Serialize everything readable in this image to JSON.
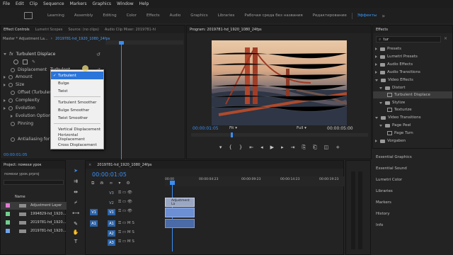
{
  "menu": [
    "File",
    "Edit",
    "Clip",
    "Sequence",
    "Markers",
    "Graphics",
    "Window",
    "Help"
  ],
  "workspaces": [
    "Learning",
    "Assembly",
    "Editing",
    "Color",
    "Effects",
    "Audio",
    "Graphics",
    "Libraries",
    "Рабочая среда без названия",
    "Редактирование",
    "Эффекты"
  ],
  "effect_controls": {
    "tabs": [
      "Effect Controls",
      "Lumetri Scopes",
      "Source: (no clips)",
      "Audio Clip Mixer: 2019781-hl"
    ],
    "master_label": "Master * Adjustment La...",
    "sequence_label": "2019781-hd_1920_1080_24fps",
    "effect_name": "Turbulent Displace",
    "properties": [
      "Displacement",
      "Amount",
      "Size",
      "Offset (Turbulen...",
      "Complexity",
      "Evolution",
      "Evolution Options",
      "Pinning",
      "",
      "Antialiasing for ..."
    ],
    "displacement_value": "Turbulent",
    "timecode": "00:00:01:05"
  },
  "dropdown": {
    "items": [
      "Turbulent",
      "Bulge",
      "Twist",
      "Turbulent Smoother",
      "Bulge Smoother",
      "Twist Smoother",
      "Vertical Displacement",
      "Horizontal Displacement",
      "Cross Displacement"
    ],
    "selected": "Turbulent"
  },
  "program": {
    "title": "Program: 2019781-hd_1920_1080_24fps",
    "timecode": "00:00:01:05",
    "fit": "Fit",
    "quality": "Full",
    "duration": "00:00:05:00"
  },
  "effects_panel": {
    "title": "Effects",
    "search": "tur",
    "items": [
      {
        "label": "Presets",
        "type": "folder"
      },
      {
        "label": "Lumetri Presets",
        "type": "folder"
      },
      {
        "label": "Audio Effects",
        "type": "folder"
      },
      {
        "label": "Audio Transitions",
        "type": "folder"
      },
      {
        "label": "Video Effects",
        "type": "folder"
      },
      {
        "label": "Distort",
        "type": "folder"
      },
      {
        "label": "Turbulent Displace",
        "type": "effect"
      },
      {
        "label": "Stylize",
        "type": "folder"
      },
      {
        "label": "Texturize",
        "type": "effect"
      },
      {
        "label": "Video Transitions",
        "type": "folder"
      },
      {
        "label": "Page Peel",
        "type": "folder"
      },
      {
        "label": "Page Turn",
        "type": "effect"
      },
      {
        "label": "Vorgaben",
        "type": "folder"
      }
    ],
    "side_panels": [
      "Essential Graphics",
      "Essential Sound",
      "Lumetri Color",
      "Libraries",
      "Markers",
      "History",
      "Info"
    ]
  },
  "project": {
    "title": "Project: помехи урок",
    "file": "помехи урок.prproj",
    "column": "Name",
    "items": [
      "Adjustment Layer",
      "1994829-hd_1920...",
      "2019781-hd_1920...",
      "2019781-hd_1920..."
    ]
  },
  "timeline": {
    "title": "2019781-hd_1920_1080_24fps",
    "timecode": "00:00:01:05",
    "ruler": [
      "00:00",
      "00:00:04:23",
      "00:00:09:23",
      "00:00:14:23",
      "00:00:19:23"
    ],
    "video_tracks": [
      "V3",
      "V2",
      "V1"
    ],
    "audio_tracks": [
      "A1",
      "A2",
      "A3"
    ],
    "source_v": "V1",
    "source_a": "A1",
    "clip_label": "Adjustment La"
  },
  "colors": {
    "accent": "#2d8ceb",
    "clip_blue": "#6d8fd3",
    "adjust_clip": "#9aa7c4"
  }
}
